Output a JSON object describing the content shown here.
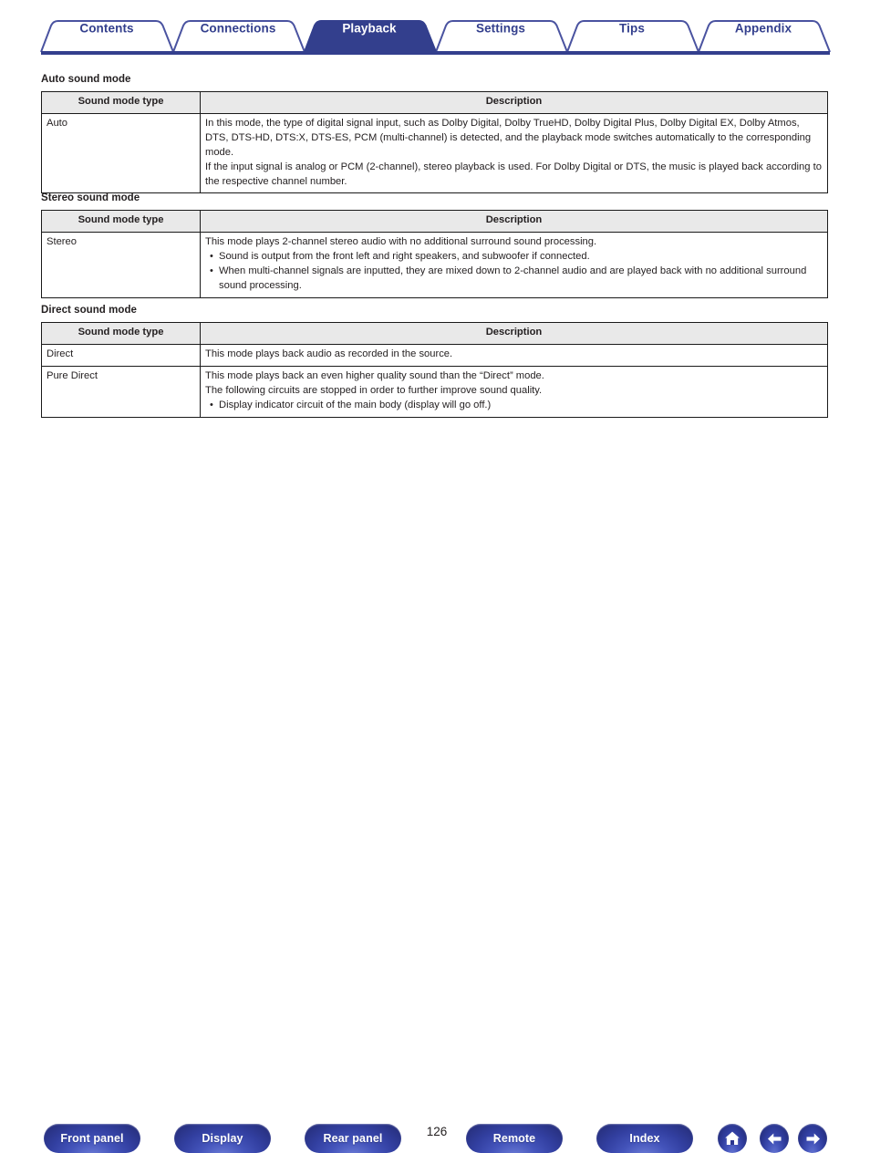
{
  "colors": {
    "brand_blue": "#333f8d",
    "active_tab_bg": "#333f8d",
    "table_header_bg": "#e9e9e9",
    "table_border": "#1a1a1a",
    "text": "#231f20"
  },
  "nav_tabs": [
    {
      "label": "Contents",
      "active": false
    },
    {
      "label": "Connections",
      "active": false
    },
    {
      "label": "Playback",
      "active": true
    },
    {
      "label": "Settings",
      "active": false
    },
    {
      "label": "Tips",
      "active": false
    },
    {
      "label": "Appendix",
      "active": false
    }
  ],
  "sections": [
    {
      "title": "Auto sound mode",
      "headers": {
        "type": "Sound mode type",
        "description": "Description"
      },
      "rows": [
        {
          "type": "Auto",
          "paragraphs": [
            "In this mode, the type of digital signal input, such as Dolby Digital, Dolby TrueHD, Dolby Digital Plus, Dolby Digital EX, Dolby Atmos, DTS, DTS-HD, DTS:X, DTS-ES, PCM (multi-channel) is detected, and the playback mode switches automatically to the corresponding mode.",
            "If the input signal is analog or PCM (2-channel), stereo playback is used. For Dolby Digital or DTS, the music is played back according to the respective channel number."
          ],
          "bullets": []
        }
      ]
    },
    {
      "title": "Stereo sound mode",
      "headers": {
        "type": "Sound mode type",
        "description": "Description"
      },
      "rows": [
        {
          "type": "Stereo",
          "paragraphs": [
            "This mode plays 2-channel stereo audio with no additional surround sound processing."
          ],
          "bullets": [
            "Sound is output from the front left and right speakers, and subwoofer if connected.",
            "When multi-channel signals are inputted, they are mixed down to 2-channel audio and are played back with no additional surround sound processing."
          ]
        }
      ]
    },
    {
      "title": "Direct sound mode",
      "headers": {
        "type": "Sound mode type",
        "description": "Description"
      },
      "rows": [
        {
          "type": "Direct",
          "paragraphs": [
            "This mode plays back audio as recorded in the source."
          ],
          "bullets": []
        },
        {
          "type": "Pure Direct",
          "paragraphs": [
            "This mode plays back an even higher quality sound than the “Direct” mode.",
            "The following circuits are stopped in order to further improve sound quality."
          ],
          "bullets": [
            "Display indicator circuit of the main body (display will go off.)"
          ]
        }
      ]
    }
  ],
  "footer": {
    "buttons": [
      {
        "label": "Front panel"
      },
      {
        "label": "Display"
      },
      {
        "label": "Rear panel"
      },
      {
        "label": "Remote"
      },
      {
        "label": "Index"
      }
    ],
    "page_number": "126",
    "icon_buttons": [
      {
        "icon": "home-icon"
      },
      {
        "icon": "arrow-left-icon"
      },
      {
        "icon": "arrow-right-icon"
      }
    ]
  }
}
